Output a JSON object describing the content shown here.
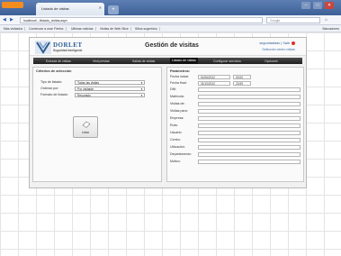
{
  "browser": {
    "tab_title": "Listado de visitas",
    "url": "localhost/.../listado_visitas.aspx",
    "search_placeholder": "Google",
    "bookmarks": [
      "Más visitados",
      "Comenzar a usar Firefox",
      "Ultimas noticias",
      "Visitas de Web Slice",
      "Sitios sugeridos"
    ],
    "bookmarks_right": "Marcadores"
  },
  "app": {
    "logo_name": "DORLET",
    "logo_tagline": "Seguridad Inteligente",
    "title": "Gestión de visitas",
    "user": "seguridaddav",
    "logout": "Salir",
    "center_link": "Selección centro visitas",
    "menu": [
      "Entrada de visitas",
      "Visit previas",
      "Salida de visitas",
      "Listado de visitas",
      "Configurar servicios",
      "Opciones"
    ],
    "active_menu": "Listado de visitas"
  },
  "criteria": {
    "title": "Criterios de selección",
    "fields": [
      {
        "label": "Tipo de listado:",
        "value": "Todas las visitas"
      },
      {
        "label": "Ordenar por:",
        "value": "Por visitante"
      },
      {
        "label": "Formato de listado:",
        "value": "Resumido"
      }
    ],
    "button_label": "Listar"
  },
  "params": {
    "title": "Parámetros:",
    "fecha_inicial_label": "Fecha inicial:",
    "fecha_inicial_date": "01/06/2012",
    "fecha_inicial_time": "00:00",
    "fecha_final_label": "Fecha final:",
    "fecha_final_date": "31/10/2012",
    "fecha_final_time": "23:59",
    "fields": [
      "DNI:",
      "Matrícula:",
      "Visitas de:",
      "Visitas para:",
      "Empresa:",
      "Ruta:",
      "Usuario:",
      "Centro:",
      "Ubicación:",
      "Departamento:",
      "Motivo:"
    ]
  },
  "colors": {
    "menu_bg": "#2a2a2a",
    "brand": "#2b5c94",
    "logout": "#d9312d"
  }
}
